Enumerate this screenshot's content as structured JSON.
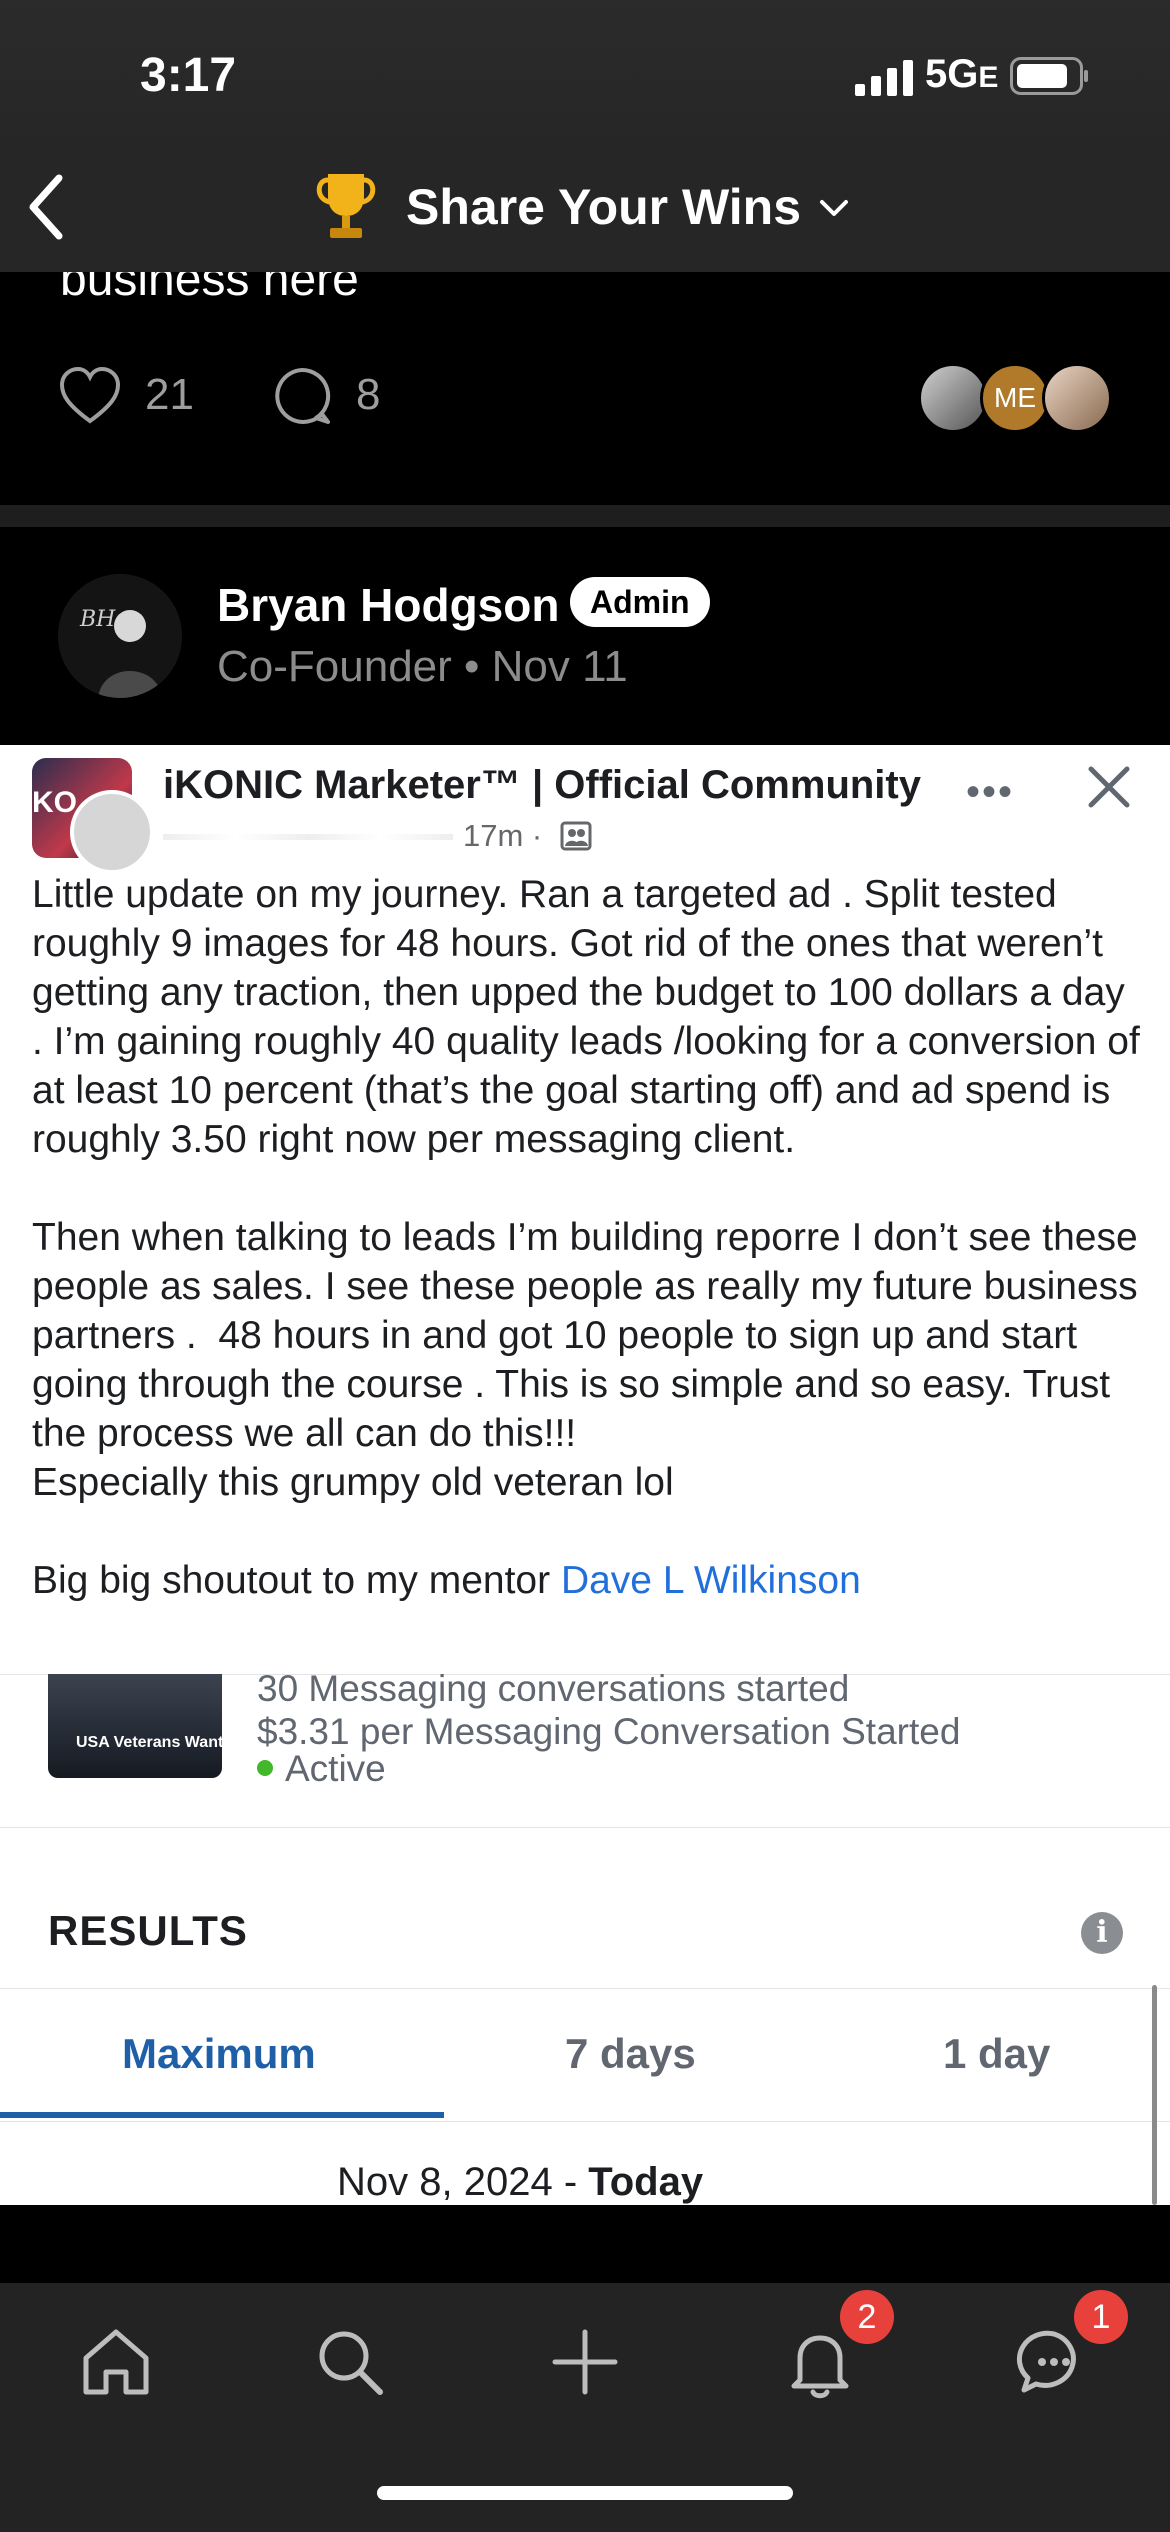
{
  "status_bar": {
    "time": "3:17",
    "network": "5G",
    "network_suffix": "E"
  },
  "nav": {
    "title": "Share Your Wins"
  },
  "prev_post": {
    "cut_text": "business here",
    "likes": "21",
    "comments": "8",
    "avatar_initials": "ME"
  },
  "post": {
    "author": "Bryan Hodgson",
    "badge": "Admin",
    "role_line": "Co-Founder • Nov 11"
  },
  "screenshot": {
    "group_name": "iKONIC Marketer™ | Official Community",
    "meta": "17m ·",
    "body_text": "Little update on my journey. Ran a targeted ad . Split tested roughly 9 images for 48 hours. Got rid of the ones that weren’t getting any traction, then upped the budget to 100 dollars a day . I’m gaining roughly 40 quality leads /looking for a conversion of at least 10 percent (that’s the goal starting off) and ad spend is roughly 3.50 right now per messaging client.\n\nThen when talking to leads I’m building reporre I don’t see these people as sales. I see these people as really my future business partners .  48 hours in and got 10 people to sign up and start going through the course . This is so simple and so easy. Trust the process we all can do this!!!\nEspecially this grumpy old veteran lol\n\nBig big shoutout to my mentor ",
    "mention": "Dave L Wilkinson",
    "ad": {
      "thumb_text": "USA Veterans Wanted!",
      "line1": "30 Messaging conversations started",
      "line2": "$3.31 per Messaging Conversation Started",
      "status": "Active"
    },
    "results_label": "RESULTS",
    "tabs": [
      "Maximum",
      "7 days",
      "1 day"
    ],
    "date_range_prefix": "Nov 8, 2024 - ",
    "date_range_bold": "Today"
  },
  "tab_bar": {
    "notifications_badge": "2",
    "messages_badge": "1"
  }
}
